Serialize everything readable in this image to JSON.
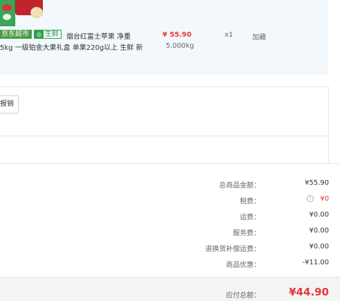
{
  "product": {
    "tag_store": "京东超市",
    "tag_fresh": "生鲜",
    "tag_fresh_icon": "fresh-icon",
    "title_line1": "烟台红富士苹果 净重",
    "title_line2": "5kg 一级铂金大果礼盒 单果220g以上 生鲜 新",
    "price": "¥ 55.90",
    "weight": "5.000kg",
    "quantity": "x1",
    "action": "加藏"
  },
  "service": {
    "button_label": "报销"
  },
  "summary": {
    "rows": [
      {
        "label": "总商品金额：",
        "value": "¥55.90"
      },
      {
        "label": "税费：",
        "value": "¥0"
      },
      {
        "label": "运费：",
        "value": "¥0.00"
      },
      {
        "label": "服务费：",
        "value": "¥0.00"
      },
      {
        "label": "退换货补偿运费：",
        "value": "¥0.00"
      },
      {
        "label": "商品优惠：",
        "value": "-¥11.00"
      }
    ],
    "tax_info_icon": "info-icon",
    "total_label": "应付总额：",
    "total_value": "¥44.90"
  },
  "colors": {
    "accent_red": "#e4393c",
    "jd_green": "#4a9a45",
    "panel_bg": "#f3f8fd"
  }
}
